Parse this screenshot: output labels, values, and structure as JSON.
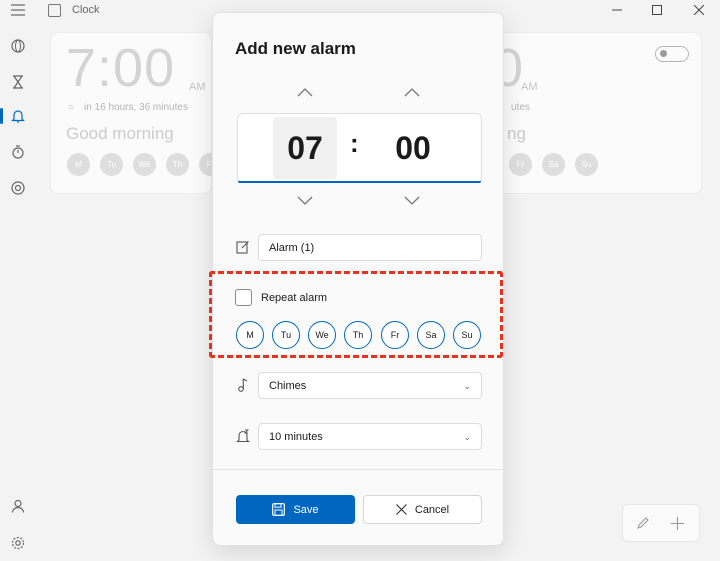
{
  "window": {
    "title": "Clock",
    "controls": [
      "minimize",
      "maximize",
      "close"
    ]
  },
  "nav": {
    "items": [
      {
        "name": "world-clock-icon"
      },
      {
        "name": "timer-icon"
      },
      {
        "name": "alarm-icon",
        "active": true
      },
      {
        "name": "stopwatch-icon"
      },
      {
        "name": "focus-icon"
      }
    ],
    "bottom": [
      {
        "name": "account-icon"
      },
      {
        "name": "settings-icon"
      }
    ]
  },
  "background_alarm_left": {
    "time": "7:00",
    "ampm": "AM",
    "relative": "in 16 hours, 36 minutes",
    "label": "Good morning",
    "days": [
      "M",
      "Tu",
      "We",
      "Th",
      "Fr"
    ]
  },
  "background_alarm_right": {
    "time": "0",
    "ampm": "AM",
    "relative": "utes",
    "label": "ng",
    "days": [
      "Fr",
      "Sa",
      "Su"
    ]
  },
  "dialog": {
    "title": "Add new alarm",
    "hour": "07",
    "minute": "00",
    "separator": ":",
    "alarm_name": "Alarm (1)",
    "repeat_label": "Repeat alarm",
    "repeat_checked": false,
    "days": [
      "M",
      "Tu",
      "We",
      "Th",
      "Fr",
      "Sa",
      "Su"
    ],
    "sound": "Chimes",
    "snooze": "10 minutes",
    "save_label": "Save",
    "cancel_label": "Cancel"
  },
  "colors": {
    "accent": "#0067c0",
    "highlight": "#e8321d"
  }
}
